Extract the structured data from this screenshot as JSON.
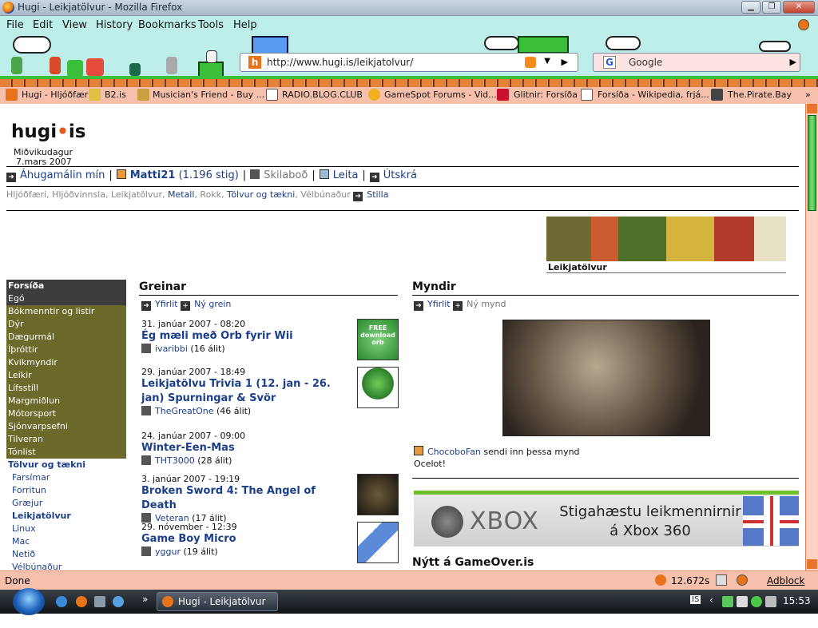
{
  "window": {
    "title": "Hugi - Leikjatölvur - Mozilla Firefox",
    "min": "▁",
    "max": "❐",
    "close": "✕"
  },
  "menu": [
    "File",
    "Edit",
    "View",
    "History",
    "Bookmarks",
    "Tools",
    "Help"
  ],
  "toolbar": {
    "url": "http://www.hugi.is/leikjatolvur/",
    "search_placeholder": "Google"
  },
  "bookmarks": [
    "Hugi - Hljóðfæri",
    "B2.is",
    "Musician's Friend - Buy ...",
    "RADIO.BLOG.CLUB",
    "GameSpot Forums - Vid...",
    "Glitnir: Forsíða",
    "Forsíða - Wikipedia, frjá...",
    "The.Pirate.Bay"
  ],
  "page": {
    "logo": "hugi",
    "logo_tld": "is",
    "day": "Miðvikudagur",
    "date": "7.mars 2007",
    "userbar": {
      "my_interests": "Áhugamálin mín",
      "user": "Matti21",
      "points": "(1.196 stig)",
      "messages": "Skilaboð",
      "search": "Leita",
      "logout": "Útskrá"
    },
    "interests": {
      "prefix": "Hljóðfæri, Hljóðvinnsla, Leikjatölvur,",
      "metall": "Metall",
      "mid": ", Rokk,",
      "tolvur": "Tölvur og tækni",
      "sep": ",",
      "velbunadur": "Vélbúnaður",
      "settings": "Stilla"
    },
    "banner_caption": "Leikjatölvur",
    "sidenav": [
      "Forsíða",
      "Egó",
      "Bókmenntir og listir",
      "Dýr",
      "Dægurmál",
      "Íþróttir",
      "Kvikmyndir",
      "Leikir",
      "Lífsstíll",
      "Margmiðlun",
      "Mótorsport",
      "Sjónvarpsefni",
      "Tilveran",
      "Tónlist"
    ],
    "sidenav_category": "Tölvur og tækni",
    "sidenav_sub": [
      "Farsímar",
      "Forritun",
      "Græjur",
      "Leikjatölvur",
      "Linux",
      "Mac",
      "Netið",
      "Vélbúnaður"
    ],
    "greinar": {
      "title": "Greinar",
      "overview": "Yfirlit",
      "new": "Ný grein"
    },
    "articles": [
      {
        "date": "31. janúar 2007 - 08:20",
        "title": "Ég mæli með Orb fyrir Wii",
        "author": "ivaribbi",
        "comments": "(16 álit)"
      },
      {
        "date": "29. janúar 2007 - 18:49",
        "title": "Leikjatölvu Trivia 1 (12. jan - 26. jan) Spurningar & Svör",
        "author": "TheGreatOne",
        "comments": "(46 álit)"
      },
      {
        "date": "24. janúar 2007 - 09:00",
        "title": "Winter-Een-Mas",
        "author": "THT3000",
        "comments": "(28 álit)"
      },
      {
        "date": "3. janúar 2007 - 19:19",
        "title": "Broken Sword 4: The Angel of Death",
        "author": "Veteran",
        "comments": "(17 álit)"
      },
      {
        "date": "29. nóvember - 12:39",
        "title": "Game Boy Micro",
        "author": "yggur",
        "comments": "(19 álit)"
      }
    ],
    "thumb_orb_text": "FREE download orb",
    "myndir": {
      "title": "Myndir",
      "overview": "Yfirlit",
      "new": "Ný mynd",
      "uploader": "ChocoboFan",
      "uploader_suffix": "sendi inn þessa mynd",
      "caption": "Ocelot!"
    },
    "xbox": {
      "brand": "XBOX",
      "line1": "Stigahæstu leikmennirnir",
      "line2": "á Xbox 360"
    },
    "gameover": "Nýtt á GameOver.is"
  },
  "status": {
    "text": "Done",
    "speed": "12.672s",
    "adblock": "Adblock"
  },
  "taskbar": {
    "task": "Hugi - Leikjatölvur -...",
    "clock": "15:53",
    "lang": "IS"
  },
  "colors": {
    "menubar": "#bdeee9",
    "bookmarks": "#f7c0ac",
    "sidenav": "#6b6a2a",
    "link": "#1c3f8a"
  }
}
